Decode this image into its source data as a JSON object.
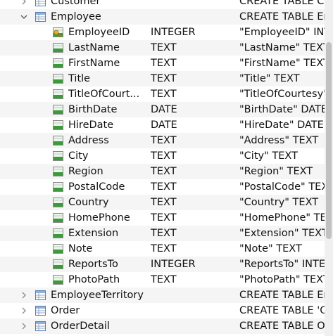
{
  "tables_before": [
    {
      "name": "Customer",
      "ddl": "CREATE TABLE Cu"
    }
  ],
  "employee_table": {
    "name": "Employee",
    "ddl": "CREATE TABLE Em",
    "columns": [
      {
        "name": "EmployeeID",
        "type": "INTEGER",
        "ddl": "\"EmployeeID\" INTE",
        "key": true
      },
      {
        "name": "LastName",
        "type": "TEXT",
        "ddl": "\"LastName\" TEXT"
      },
      {
        "name": "FirstName",
        "type": "TEXT",
        "ddl": "\"FirstName\" TEXT"
      },
      {
        "name": "Title",
        "type": "TEXT",
        "ddl": "\"Title\" TEXT"
      },
      {
        "name": "TitleOfCourt...",
        "type": "TEXT",
        "ddl": "\"TitleOfCourtesy\""
      },
      {
        "name": "BirthDate",
        "type": "DATE",
        "ddl": "\"BirthDate\" DATE"
      },
      {
        "name": "HireDate",
        "type": "DATE",
        "ddl": "\"HireDate\" DATE"
      },
      {
        "name": "Address",
        "type": "TEXT",
        "ddl": "\"Address\" TEXT"
      },
      {
        "name": "City",
        "type": "TEXT",
        "ddl": "\"City\" TEXT"
      },
      {
        "name": "Region",
        "type": "TEXT",
        "ddl": "\"Region\" TEXT"
      },
      {
        "name": "PostalCode",
        "type": "TEXT",
        "ddl": "\"PostalCode\" TEXT"
      },
      {
        "name": "Country",
        "type": "TEXT",
        "ddl": "\"Country\" TEXT"
      },
      {
        "name": "HomePhone",
        "type": "TEXT",
        "ddl": "\"HomePhone\" TEXT"
      },
      {
        "name": "Extension",
        "type": "TEXT",
        "ddl": "\"Extension\" TEXT"
      },
      {
        "name": "Note",
        "type": "TEXT",
        "ddl": "\"Note\" TEXT"
      },
      {
        "name": "ReportsTo",
        "type": "INTEGER",
        "ddl": "\"ReportsTo\" INTE"
      },
      {
        "name": "PhotoPath",
        "type": "TEXT",
        "ddl": "\"PhotoPath\" TEXT"
      }
    ]
  },
  "tables_after": [
    {
      "name": "EmployeeTerritory",
      "ddl": "CREATE TABLE Em"
    },
    {
      "name": "Order",
      "ddl": "CREATE TABLE 'O"
    },
    {
      "name": "OrderDetail",
      "ddl": "CREATE TABLE Or"
    }
  ],
  "icons": {
    "table": "table-icon",
    "column": "column-icon",
    "primary_key_column": "key-column-icon",
    "expanded": "chevron-down-icon",
    "collapsed": "chevron-right-icon"
  },
  "colors": {
    "column_icon_green": "#3c9a3c",
    "key_yellow": "#e6b422",
    "table_icon_blue": "#5a7fb0",
    "alt_row": "#f5f5f5"
  }
}
